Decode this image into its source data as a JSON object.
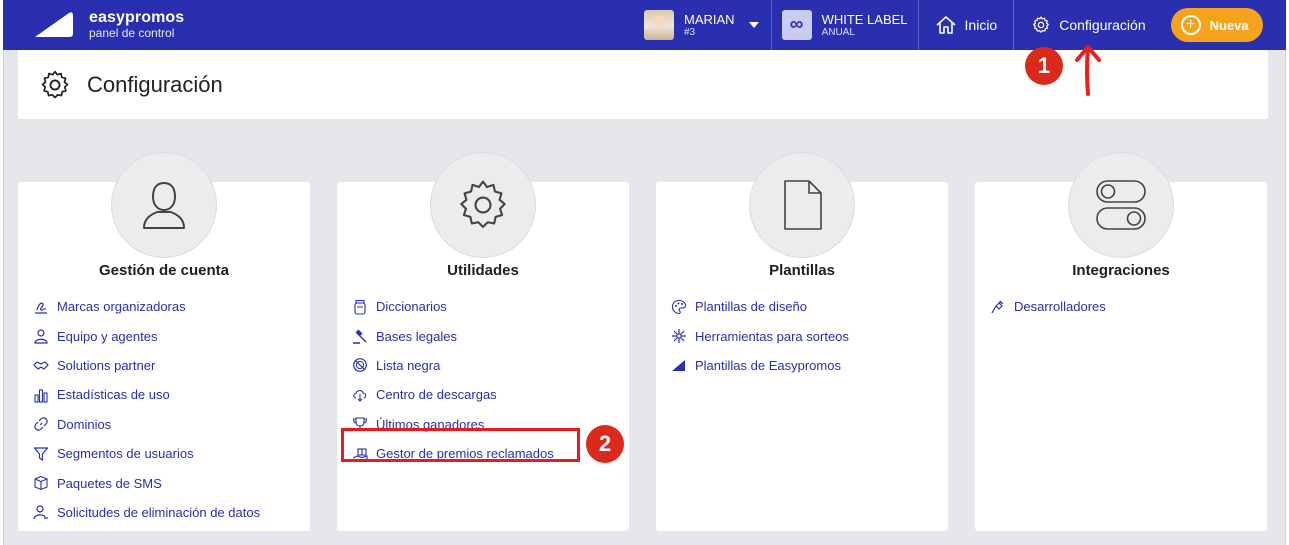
{
  "brand": {
    "name": "easypromos",
    "subtitle": "panel de control"
  },
  "user": {
    "name": "MARIAN",
    "id": "#3"
  },
  "plan": {
    "icon": "infinity-icon",
    "name": "WHITE LABEL",
    "type": "ANUAL"
  },
  "nav": {
    "home": "Inicio",
    "settings": "Configuración",
    "new": "Nueva"
  },
  "page": {
    "title": "Configuración"
  },
  "cards": [
    {
      "title": "Gestión de cuenta",
      "icon": "user-icon",
      "items": [
        {
          "label": "Marcas organizadoras",
          "icon": "signature-icon"
        },
        {
          "label": "Equipo y agentes",
          "icon": "user-outline-icon"
        },
        {
          "label": "Solutions partner",
          "icon": "handshake-icon"
        },
        {
          "label": "Estadísticas de uso",
          "icon": "bar-chart-icon"
        },
        {
          "label": "Dominios",
          "icon": "link-icon"
        },
        {
          "label": "Segmentos de usuarios",
          "icon": "filter-icon"
        },
        {
          "label": "Paquetes de SMS",
          "icon": "box-icon"
        },
        {
          "label": "Solicitudes de eliminación de datos",
          "icon": "user-remove-icon"
        }
      ]
    },
    {
      "title": "Utilidades",
      "icon": "gear-icon",
      "items": [
        {
          "label": "Diccionarios",
          "icon": "jar-icon"
        },
        {
          "label": "Bases legales",
          "icon": "gavel-icon"
        },
        {
          "label": "Lista negra",
          "icon": "ban-icon"
        },
        {
          "label": "Centro de descargas",
          "icon": "cloud-download-icon"
        },
        {
          "label": "Últimos ganadores",
          "icon": "trophy-icon"
        },
        {
          "label": "Gestor de premios reclamados",
          "icon": "gift-hand-icon"
        }
      ]
    },
    {
      "title": "Plantillas",
      "icon": "document-icon",
      "items": [
        {
          "label": "Plantillas de diseño",
          "icon": "palette-icon"
        },
        {
          "label": "Herramientas para sorteos",
          "icon": "sparkle-icon"
        },
        {
          "label": "Plantillas de Easypromos",
          "icon": "logo-triangle-icon"
        }
      ]
    },
    {
      "title": "Integraciones",
      "icon": "toggle-icon",
      "items": [
        {
          "label": "Desarrolladores",
          "icon": "plug-icon"
        }
      ]
    }
  ],
  "annotations": {
    "step1": "1",
    "step2": "2"
  },
  "colors": {
    "nav": "#2a2faf",
    "accent": "#f7a21b",
    "link": "#2a2faf",
    "annotation": "#d92a1c"
  }
}
